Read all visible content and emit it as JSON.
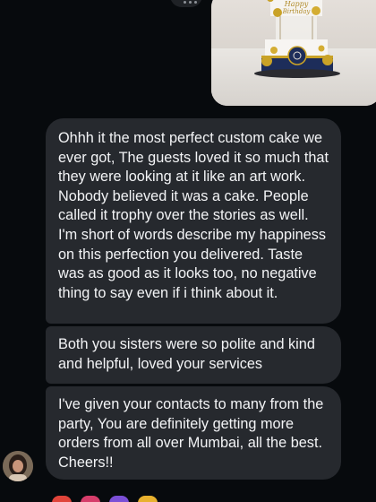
{
  "conversation": {
    "messages": [
      {
        "text": "Ohhh it the most perfect custom cake we ever got, The guests loved it so much that they were looking at it like an art work. Nobody believed it was a cake. People called it trophy over the stories as well. I'm short of words describe my happiness on this perfection you delivered. Taste was as good as it looks too, no negative thing to say even if i think about it."
      },
      {
        "text": "Both you sisters were so polite and kind and helpful, loved your services"
      },
      {
        "text": "I've given your contacts to many from the party, You are definitely getting more orders from all over Mumbai, all the best. Cheers!!"
      }
    ]
  },
  "icons": {
    "reaction": "more-dots-icon",
    "avatar": "user-avatar",
    "emoji_row": "reaction-emoji-icons"
  },
  "colors": {
    "background": "#070a0d",
    "bubble": "#26292e",
    "text": "#f3f4f6",
    "cake_navy": "#1d2d5a",
    "cake_gold": "#c9a227"
  }
}
